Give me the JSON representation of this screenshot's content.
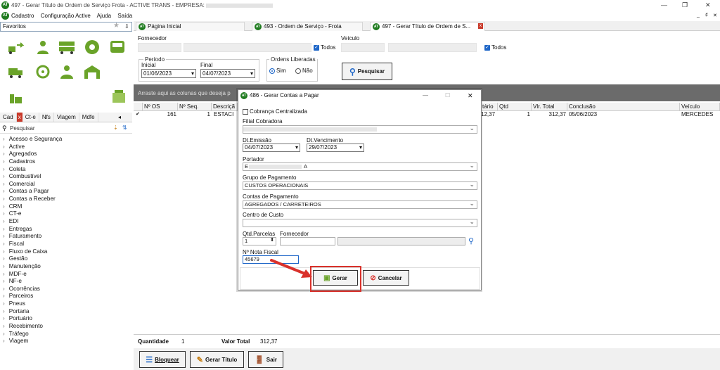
{
  "window": {
    "title": "497 - Gerar Título de Ordem de Serviço Frota - ACTIVE TRANS - EMPRESA:",
    "controls": {
      "minimize": "—",
      "restore": "❐",
      "close": "✕"
    },
    "inner_controls": {
      "minimize": "_",
      "restore": "♯",
      "close": "✕"
    }
  },
  "menu": [
    "Cadastro",
    "Configuração Active",
    "Ajuda",
    "Saída"
  ],
  "favorites": {
    "label": "Favoritos",
    "pin": "⇩"
  },
  "left_tabs": [
    "Cad",
    "Ct-e",
    "Nfs",
    "Viagem",
    "Mdfe"
  ],
  "search": {
    "placeholder": "Pesquisar"
  },
  "tree": [
    "Acesso e Segurança",
    "Active",
    "Agregados",
    "Cadastros",
    "Coleta",
    "Combustível",
    "Comercial",
    "Contas a Pagar",
    "Contas a Receber",
    "CRM",
    "CT-e",
    "EDI",
    "Entregas",
    "Faturamento",
    "Fiscal",
    "Fluxo de Caixa",
    "Gestão",
    "Manutenção",
    "MDF-e",
    "NF-e",
    "Ocorrências",
    "Parceiros",
    "Pneus",
    "Portaria",
    "Portuário",
    "Recebimento",
    "Tráfego",
    "Viagem"
  ],
  "tabs": [
    {
      "label": "Página Inicial"
    },
    {
      "label": "493 - Ordem de Serviço - Frota"
    },
    {
      "label": "497 - Gerar Título de Ordem de S..."
    }
  ],
  "filters": {
    "fornecedor_label": "Fornecedor",
    "veiculo_label": "Veículo",
    "todos": "Todos",
    "periodo": "Período",
    "inicial_label": "Inicial",
    "inicial": "01/06/2023",
    "final_label": "Final",
    "final": "04/07/2023",
    "ordens": "Ordens Liberadas",
    "sim": "Sim",
    "nao": "Não",
    "pesquisar": "Pesquisar"
  },
  "grid": {
    "drag_hint": "Arraste aqui as colunas que deseja p",
    "headers": [
      "Nº OS",
      "Nº Seq.",
      "Descriçã",
      "tário",
      "Qtd",
      "Vlr. Total",
      "Conclusão",
      "Veículo"
    ],
    "row": {
      "os": "161",
      "seq": "1",
      "desc": "ESTACI",
      "valor": "12,37",
      "qtd": "1",
      "total": "312,37",
      "conclusao": "05/06/2023",
      "veiculo": "MERCEDES BE"
    }
  },
  "footer": {
    "quantidade_label": "Quantidade",
    "quantidade": "1",
    "valor_label": "Valor Total",
    "valor": "312,37"
  },
  "buttons": {
    "bloquear": "Bloquear",
    "gerar_titulo": "Gerar Título",
    "sair": "Sair"
  },
  "dialog": {
    "title": "486 - Gerar Contas a Pagar",
    "centralizada": "Cobrança Centralizada",
    "filial_label": "Filial Cobradora",
    "emissao_label": "Dt.Emissão",
    "emissao": "04/07/2023",
    "vencimento_label": "Dt.Vencimento",
    "vencimento": "29/07/2023",
    "portador_label": "Portador",
    "portador": "E",
    "portador_end": "A",
    "grupo_label": "Grupo de Pagamento",
    "grupo": "CUSTOS OPERACIONAIS",
    "contas_label": "Contas de Pagamento",
    "contas": "AGREGADOS / CARRETEIROS",
    "centro_label": "Centro de Custo",
    "parcelas_label": "Qtd.Parcelas",
    "parcelas": "1",
    "fornecedor_label": "Fornecedor",
    "nf_label": "Nº Nota Fiscal",
    "nf": "45679",
    "gerar": "Gerar",
    "cancelar": "Cancelar"
  },
  "colors": {
    "highlight": "#d9312b",
    "accent": "#1f67c8",
    "brand": "#1e7b1e"
  }
}
